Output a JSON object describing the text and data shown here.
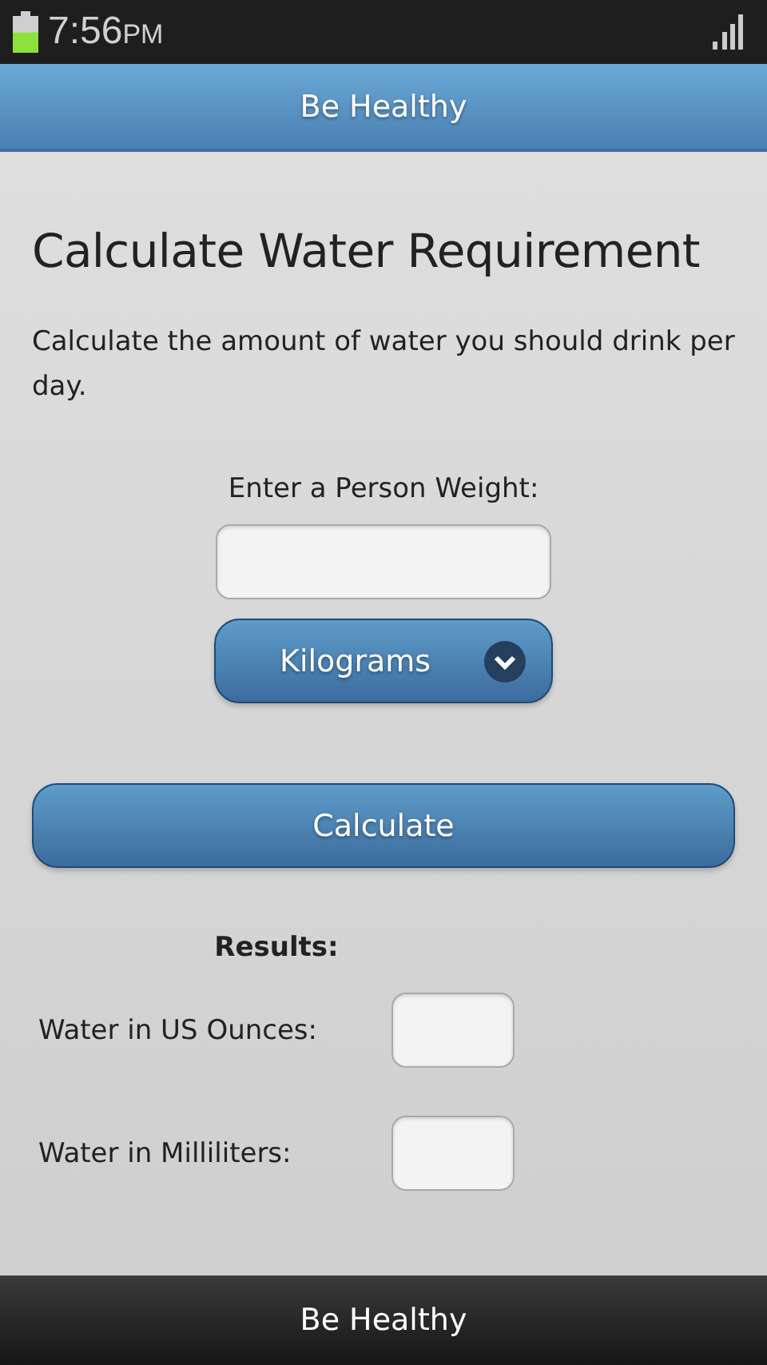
{
  "status_bar": {
    "time": "7:56",
    "meridiem": "PM"
  },
  "header": {
    "title": "Be Healthy"
  },
  "page": {
    "heading": "Calculate Water Requirement",
    "description": "Calculate the amount of water you should drink per day.",
    "weight_label": "Enter a Person Weight:",
    "unit_select": {
      "value": "Kilograms"
    },
    "calculate_button": "Calculate",
    "results_heading": "Results:",
    "results": [
      {
        "label": "Water in US Ounces:"
      },
      {
        "label": "Water in Milliliters:"
      }
    ]
  },
  "footer": {
    "title": "Be Healthy"
  }
}
